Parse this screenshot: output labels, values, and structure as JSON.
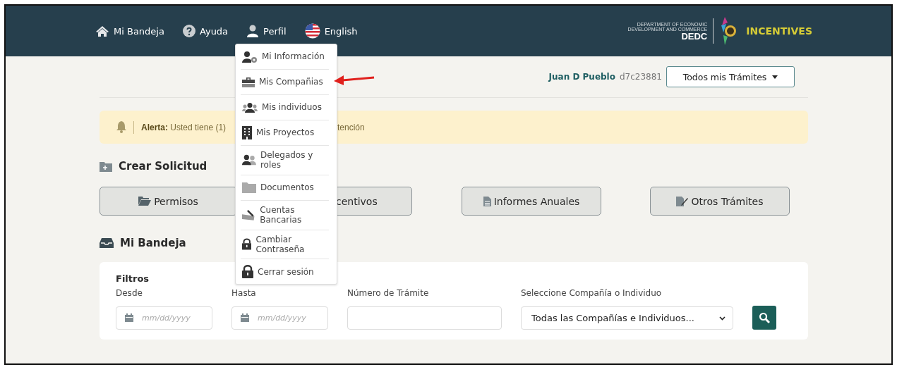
{
  "header": {
    "nav": [
      {
        "label": "Mi Bandeja"
      },
      {
        "label": "Ayuda"
      },
      {
        "label": "Perfil"
      },
      {
        "label": "English"
      }
    ],
    "logo": {
      "line_1": "DEPARTMENT OF ECONOMIC",
      "line_2": "DEVELOPMENT AND COMMERCE",
      "short": "DEDC",
      "product": "INCENTIVES"
    }
  },
  "profile_menu": {
    "items": [
      {
        "label": "Mi Información"
      },
      {
        "label": "Mis Compañias"
      },
      {
        "label": "Mis individuos"
      },
      {
        "label": "Mis Proyectos"
      },
      {
        "label": "Delegados y roles"
      },
      {
        "label": "Documentos"
      },
      {
        "label": "Cuentas Bancarias"
      },
      {
        "label": "Cambiar Contraseña"
      },
      {
        "label": "Cerrar sesión"
      }
    ]
  },
  "user": {
    "name": "Juan D Pueblo",
    "id": "d7c23881",
    "filter_button": "Todos mis Trámites"
  },
  "alert": {
    "text": "**Alerta:** Usted tiene (1)",
    "tail": "tención"
  },
  "create": {
    "title": "Crear Solicitud",
    "buttons": [
      {
        "label": "Permisos"
      },
      {
        "label": "centivos"
      },
      {
        "label": "Informes Anuales"
      },
      {
        "label": "Otros Trámites"
      }
    ]
  },
  "inbox": {
    "title": "Mi Bandeja",
    "filters": {
      "title": "Filtros",
      "fields": [
        {
          "kind": "date",
          "label": "Desde",
          "placeholder": "mm/dd/yyyy"
        },
        {
          "kind": "date",
          "label": "Hasta",
          "placeholder": "mm/dd/yyyy"
        },
        {
          "kind": "text",
          "label": "Número de Trámite"
        },
        {
          "kind": "select",
          "label": "Seleccione Compañía o Individuo",
          "value": "Todas las Compañías e Individuos..."
        }
      ]
    }
  }
}
